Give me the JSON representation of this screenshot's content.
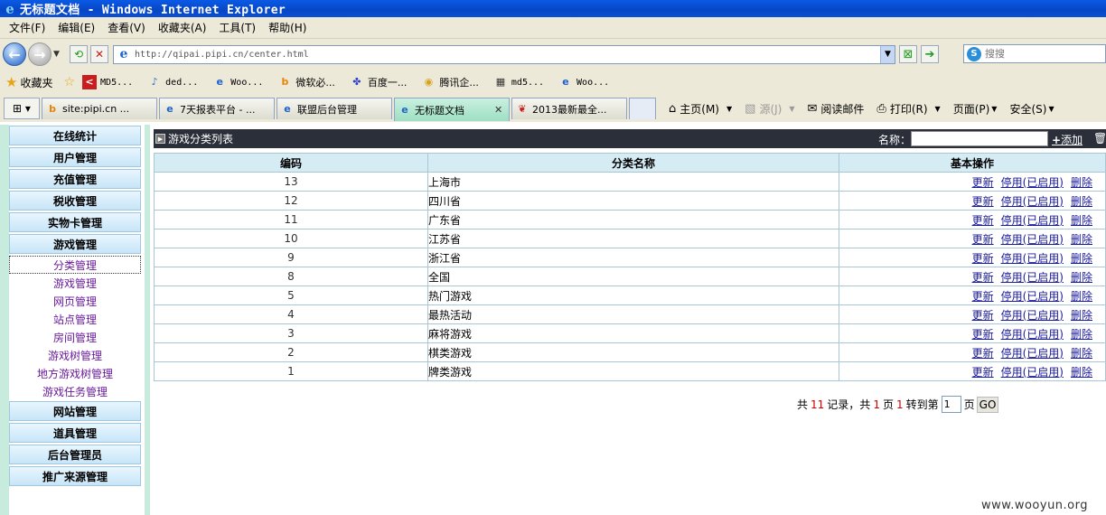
{
  "window": {
    "title": "无标题文档 - Windows Internet Explorer"
  },
  "menubar": [
    "文件(F)",
    "编辑(E)",
    "查看(V)",
    "收藏夹(A)",
    "工具(T)",
    "帮助(H)"
  ],
  "address": {
    "url": "http://qipai.pipi.cn/center.html"
  },
  "search": {
    "placeholder": "搜搜"
  },
  "favorites": {
    "label": "收藏夹",
    "items": [
      "MD5...",
      "ded...",
      "Woo...",
      "微软必...",
      "百度一...",
      "腾讯企...",
      "md5...",
      "Woo..."
    ]
  },
  "tabs": [
    {
      "label": "site:pipi.cn ..."
    },
    {
      "label": "7天报表平台 - ..."
    },
    {
      "label": "联盟后台管理"
    },
    {
      "label": "无标题文档"
    },
    {
      "label": "2013最新最全..."
    }
  ],
  "commands": {
    "home": "主页(M)",
    "feeds": "源(J)",
    "mail": "阅读邮件",
    "print": "打印(R)",
    "page": "页面(P)",
    "safety": "安全(S)"
  },
  "leftnav": {
    "groups_top": [
      "在线统计",
      "用户管理",
      "充值管理",
      "税收管理",
      "实物卡管理",
      "游戏管理"
    ],
    "sub_items": [
      "分类管理",
      "游戏管理",
      "网页管理",
      "站点管理",
      "房间管理",
      "游戏树管理",
      "地方游戏树管理",
      "游戏任务管理"
    ],
    "groups_bottom": [
      "网站管理",
      "道具管理",
      "后台管理员",
      "推广来源管理"
    ]
  },
  "list": {
    "title": "游戏分类列表",
    "name_label": "名称：",
    "add_label": "添加",
    "columns": [
      "编码",
      "分类名称",
      "基本操作"
    ],
    "ops": {
      "update": "更新",
      "toggle": "停用(已启用)",
      "delete": "删除"
    },
    "rows": [
      {
        "id": "13",
        "name": "上海市"
      },
      {
        "id": "12",
        "name": "四川省"
      },
      {
        "id": "11",
        "name": "广东省"
      },
      {
        "id": "10",
        "name": "江苏省"
      },
      {
        "id": "9",
        "name": "浙江省"
      },
      {
        "id": "8",
        "name": "全国"
      },
      {
        "id": "5",
        "name": "热门游戏"
      },
      {
        "id": "4",
        "name": "最热活动"
      },
      {
        "id": "3",
        "name": "麻将游戏"
      },
      {
        "id": "2",
        "name": "棋类游戏"
      },
      {
        "id": "1",
        "name": "牌类游戏"
      }
    ]
  },
  "pager": {
    "p1": "共",
    "total": "11",
    "p2": "记录，共",
    "pages": "1",
    "p3": "页",
    "current": "1",
    "p4": "转到第",
    "input": "1",
    "p5": "页",
    "go": "GO"
  },
  "watermark": "www.wooyun.org"
}
